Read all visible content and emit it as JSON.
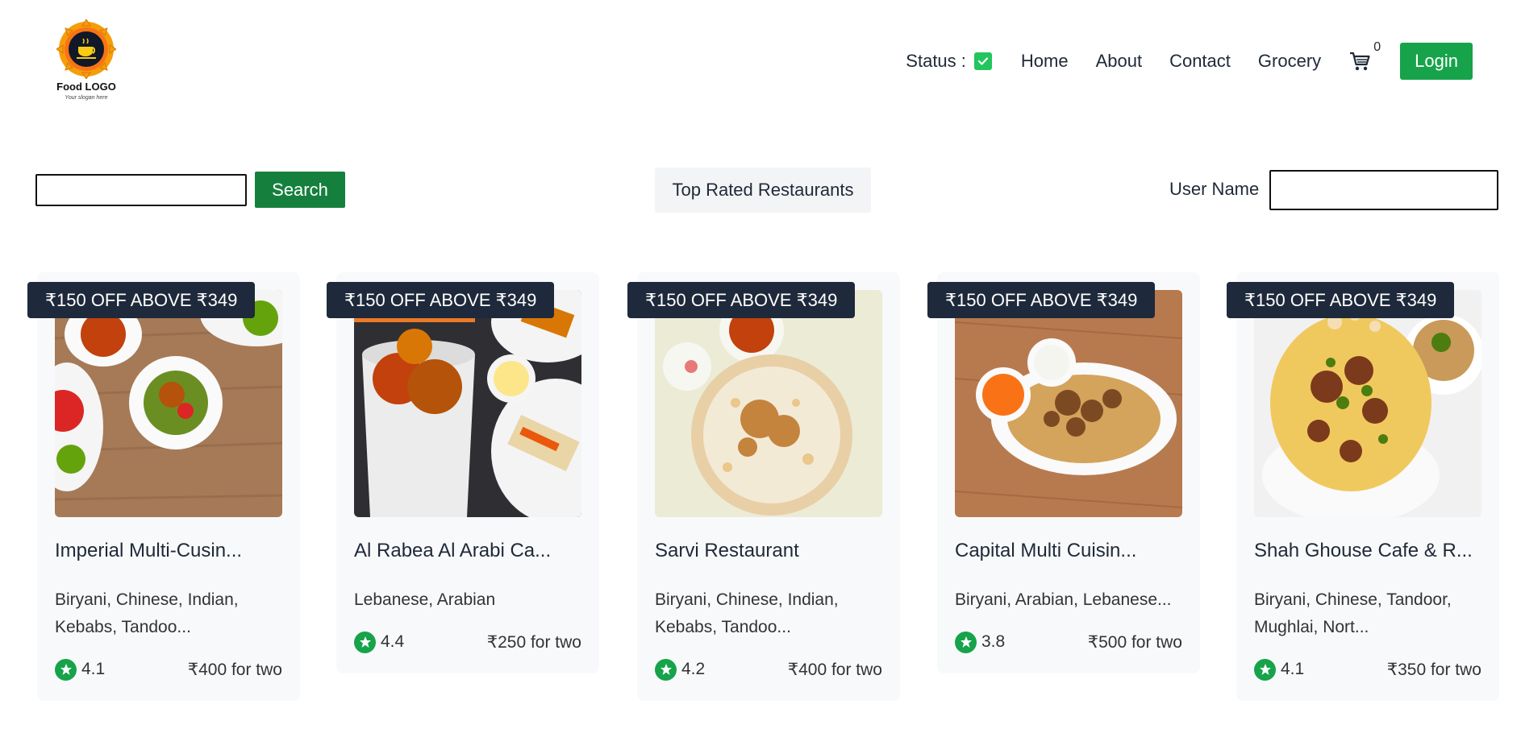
{
  "logo": {
    "title": "Food LOGO",
    "slogan": "Your slogan here"
  },
  "nav": {
    "status_label": "Status :",
    "status_checked": true,
    "links": [
      "Home",
      "About",
      "Contact",
      "Grocery"
    ],
    "cart_count": "0",
    "login_label": "Login"
  },
  "controls": {
    "search_value": "",
    "search_label": "Search",
    "top_rated_label": "Top Rated Restaurants",
    "user_name_label": "User Name",
    "user_name_value": ""
  },
  "colors": {
    "accent_green": "#16a34a",
    "offer_badge": "#1e293b",
    "card_bg": "#f8f9fb"
  },
  "restaurants": [
    {
      "offer": "₹150 OFF  ABOVE ₹349",
      "name": "Imperial Multi-Cusin...",
      "cuisines": "Biryani, Chinese, Indian, Kebabs, Tandoo...",
      "rating": "4.1",
      "cost": "₹400 for two"
    },
    {
      "offer": "₹150 OFF  ABOVE ₹349",
      "name": "Al Rabea Al Arabi Ca...",
      "cuisines": "Lebanese, Arabian",
      "rating": "4.4",
      "cost": "₹250 for two"
    },
    {
      "offer": "₹150 OFF  ABOVE ₹349",
      "name": "Sarvi Restaurant",
      "cuisines": "Biryani, Chinese, Indian, Kebabs, Tandoo...",
      "rating": "4.2",
      "cost": "₹400 for two"
    },
    {
      "offer": "₹150 OFF  ABOVE ₹349",
      "name": "Capital Multi Cuisin...",
      "cuisines": "Biryani, Arabian, Lebanese...",
      "rating": "3.8",
      "cost": "₹500 for two"
    },
    {
      "offer": "₹150 OFF  ABOVE ₹349",
      "name": "Shah Ghouse Cafe & R...",
      "cuisines": "Biryani, Chinese, Tandoor, Mughlai, Nort...",
      "rating": "4.1",
      "cost": "₹350 for two"
    }
  ]
}
